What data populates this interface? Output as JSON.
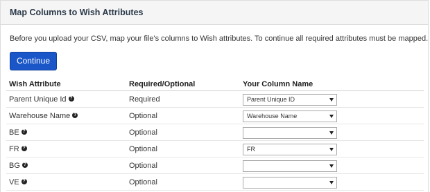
{
  "panel": {
    "title": "Map Columns to Wish Attributes"
  },
  "intro_text": "Before you upload your CSV, map your file's columns to Wish attributes. To continue all required attributes must be mapped.",
  "continue_label": "Continue",
  "table": {
    "headers": [
      "Wish Attribute",
      "Required/Optional",
      "Your Column Name"
    ],
    "rows": [
      {
        "attribute": "Parent Unique Id",
        "requirement": "Required",
        "selected": "Parent Unique ID"
      },
      {
        "attribute": "Warehouse Name",
        "requirement": "Optional",
        "selected": "Warehouse Name"
      },
      {
        "attribute": "BE",
        "requirement": "Optional",
        "selected": ""
      },
      {
        "attribute": "FR",
        "requirement": "Optional",
        "selected": "FR"
      },
      {
        "attribute": "BG",
        "requirement": "Optional",
        "selected": ""
      },
      {
        "attribute": "VE",
        "requirement": "Optional",
        "selected": ""
      }
    ]
  },
  "icons": {
    "help": "question-circle-icon",
    "dropdown": "chevron-down-icon"
  },
  "colors": {
    "accent": "#1a56c8",
    "header_bg": "#f5f5f5"
  }
}
